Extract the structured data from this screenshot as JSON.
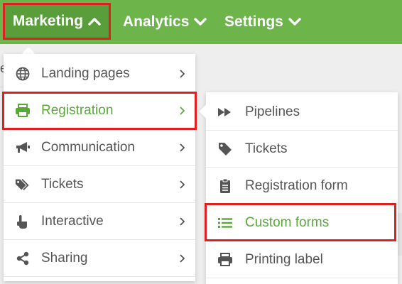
{
  "nav": {
    "marketing": "Marketing",
    "analytics": "Analytics",
    "settings": "Settings"
  },
  "background": {
    "partial_letter": "e"
  },
  "main_menu": {
    "items": [
      {
        "label": "Landing pages",
        "icon": "globe-icon"
      },
      {
        "label": "Registration",
        "icon": "printer-icon",
        "active": true
      },
      {
        "label": "Communication",
        "icon": "megaphone-icon"
      },
      {
        "label": "Tickets",
        "icon": "tags-icon"
      },
      {
        "label": "Interactive",
        "icon": "pointer-hand-icon"
      },
      {
        "label": "Sharing",
        "icon": "share-icon"
      }
    ]
  },
  "sub_menu": {
    "items": [
      {
        "label": "Pipelines",
        "icon": "fast-forward-icon"
      },
      {
        "label": "Tickets",
        "icon": "tag-icon"
      },
      {
        "label": "Registration form",
        "icon": "clipboard-icon"
      },
      {
        "label": "Custom forms",
        "icon": "list-icon",
        "active": true
      },
      {
        "label": "Printing label",
        "icon": "printer-icon"
      }
    ]
  },
  "colors": {
    "nav_bg": "#6db54a",
    "nav_active_bg": "#5a9e3b",
    "accent": "#5aa83a",
    "highlight_border": "#e02020",
    "text": "#555555"
  }
}
